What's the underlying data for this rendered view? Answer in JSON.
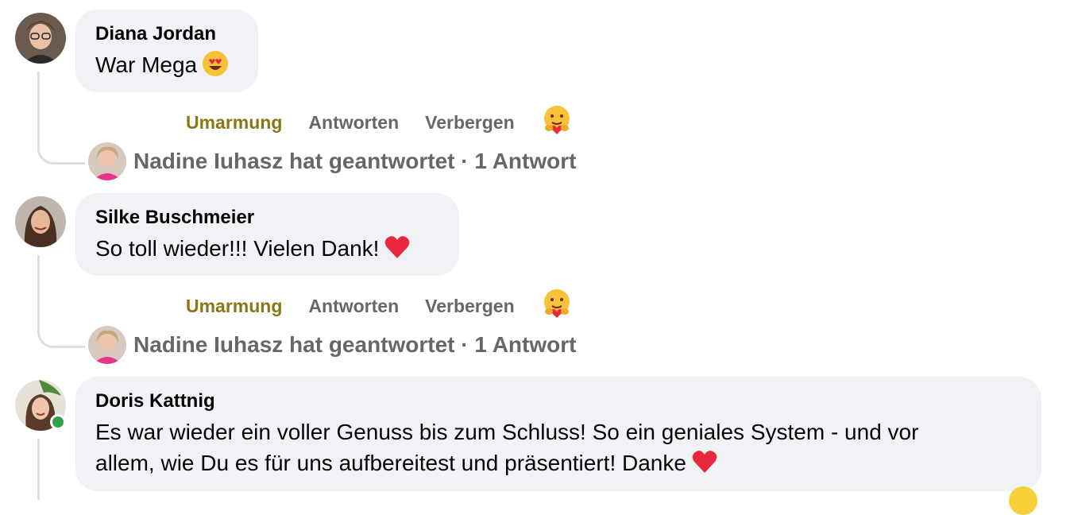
{
  "comments": [
    {
      "author": "Diana Jordan",
      "text": "War Mega",
      "emoji": "heart-eyes-icon",
      "actions": {
        "reaction": "Umarmung",
        "reply": "Antworten",
        "hide": "Verbergen"
      },
      "reply_summary": "Nadine Iuhasz hat geantwortet · 1 Antwort"
    },
    {
      "author": "Silke Buschmeier",
      "text": "So toll wieder!!! Vielen Dank!",
      "emoji": "red-heart-icon",
      "actions": {
        "reaction": "Umarmung",
        "reply": "Antworten",
        "hide": "Verbergen"
      },
      "reply_summary": "Nadine Iuhasz hat geantwortet · 1 Antwort"
    },
    {
      "author": "Doris Kattnig",
      "text_line1": "Es war wieder ein voller Genuss bis zum Schluss! So ein geniales System - und vor",
      "text_line2": "allem, wie Du es für uns aufbereitest und präsentiert! Danke",
      "emoji": "red-heart-icon"
    }
  ],
  "colors": {
    "bubble": "#f0f2f5",
    "action_text": "#65676b",
    "reacted": "#8a7615",
    "online": "#31a24c"
  }
}
